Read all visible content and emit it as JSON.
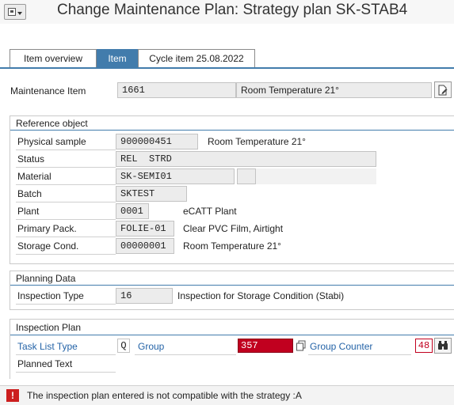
{
  "header": {
    "title": "Change Maintenance Plan: Strategy plan SK-STAB4"
  },
  "tabs": [
    {
      "label": "Item overview"
    },
    {
      "label": "Item"
    },
    {
      "label": "Cycle item 25.08.2022"
    }
  ],
  "maintenance_item": {
    "label": "Maintenance Item",
    "value": "1661",
    "description": "Room Temperature 21°"
  },
  "reference_object": {
    "title": "Reference object",
    "physical_sample": {
      "label": "Physical sample",
      "value": "900000451",
      "description": "Room Temperature 21°"
    },
    "status": {
      "label": "Status",
      "value": "REL  STRD"
    },
    "material": {
      "label": "Material",
      "value": "SK-SEMI01"
    },
    "batch": {
      "label": "Batch",
      "value": "SKTEST"
    },
    "plant": {
      "label": "Plant",
      "value": "0001",
      "description": "eCATT Plant"
    },
    "primary_pack": {
      "label": "Primary Pack.",
      "value": "FOLIE-01",
      "description": "Clear PVC Film, Airtight"
    },
    "storage_cond": {
      "label": "Storage Cond.",
      "value": "00000001",
      "description": "Room Temperature 21°"
    }
  },
  "planning_data": {
    "title": "Planning Data",
    "inspection_type": {
      "label": "Inspection Type",
      "value": "16",
      "description": "Inspection for Storage Condition (Stabi)"
    }
  },
  "inspection_plan": {
    "title": "Inspection Plan",
    "task_list_type": {
      "label": "Task List Type",
      "value": "Q"
    },
    "group": {
      "label": "Group",
      "value": "357"
    },
    "group_counter": {
      "label": "Group Counter",
      "value": "48"
    },
    "planned_text": {
      "label": "Planned Text"
    }
  },
  "status_bar": {
    "icon": "!",
    "message": "The inspection plan entered is not compatible with the strategy :A"
  },
  "colors": {
    "accent": "#427cac",
    "error": "#c1001f",
    "label_blue": "#2463a7"
  }
}
